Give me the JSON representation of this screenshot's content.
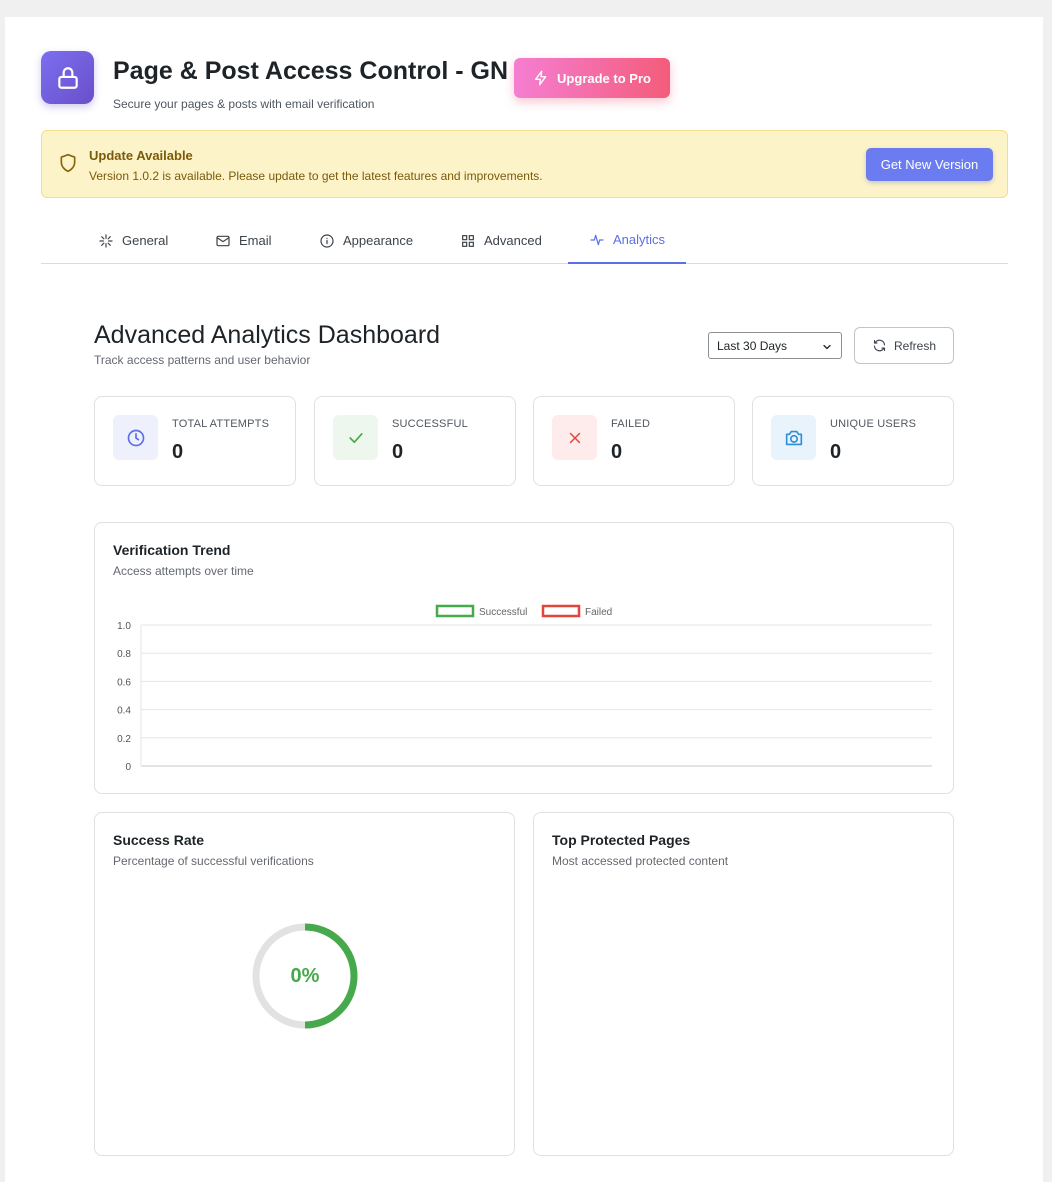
{
  "header": {
    "title": "Page & Post Access Control - GN",
    "subtitle": "Secure your pages & posts with email verification",
    "upgrade_label": "Upgrade to Pro"
  },
  "banner": {
    "title": "Update Available",
    "text": "Version 1.0.2 is available. Please update to get the latest features and improvements.",
    "button_label": "Get New Version"
  },
  "tabs": [
    {
      "label": "General",
      "icon": "sparkle-icon",
      "active": false
    },
    {
      "label": "Email",
      "icon": "mail-icon",
      "active": false
    },
    {
      "label": "Appearance",
      "icon": "info-circle-icon",
      "active": false
    },
    {
      "label": "Advanced",
      "icon": "grid-icon",
      "active": false
    },
    {
      "label": "Analytics",
      "icon": "pulse-icon",
      "active": true
    }
  ],
  "dashboard": {
    "title": "Advanced Analytics Dashboard",
    "subtitle": "Track access patterns and user behavior",
    "range_selected": "Last 30 Days",
    "refresh_label": "Refresh"
  },
  "stats": [
    {
      "label": "TOTAL ATTEMPTS",
      "value": "0",
      "icon": "clock-icon",
      "color": "#5b6fe6",
      "bg": "#eef0fc"
    },
    {
      "label": "SUCCESSFUL",
      "value": "0",
      "icon": "check-icon",
      "color": "#46a94b",
      "bg": "#edf7ee"
    },
    {
      "label": "FAILED",
      "value": "0",
      "icon": "x-icon",
      "color": "#e2453c",
      "bg": "#fdeceb"
    },
    {
      "label": "UNIQUE USERS",
      "value": "0",
      "icon": "camera-icon",
      "color": "#2e8fd6",
      "bg": "#e8f3fc"
    }
  ],
  "trend": {
    "title": "Verification Trend",
    "subtitle": "Access attempts over time"
  },
  "rate": {
    "title": "Success Rate",
    "subtitle": "Percentage of successful verifications",
    "value_text": "0%",
    "value": 0
  },
  "top_pages": {
    "title": "Top Protected Pages",
    "subtitle": "Most accessed protected content"
  },
  "chart_data": {
    "type": "line",
    "title": "",
    "xlabel": "",
    "ylabel": "",
    "x": [],
    "ylim": [
      0,
      1.0
    ],
    "y_ticks": [
      "1.0",
      "0.8",
      "0.6",
      "0.4",
      "0.2",
      "0"
    ],
    "grid": true,
    "legend": "top-center",
    "series": [
      {
        "name": "Successful",
        "color": "#46a94b",
        "values": []
      },
      {
        "name": "Failed",
        "color": "#e2453c",
        "values": []
      }
    ]
  }
}
